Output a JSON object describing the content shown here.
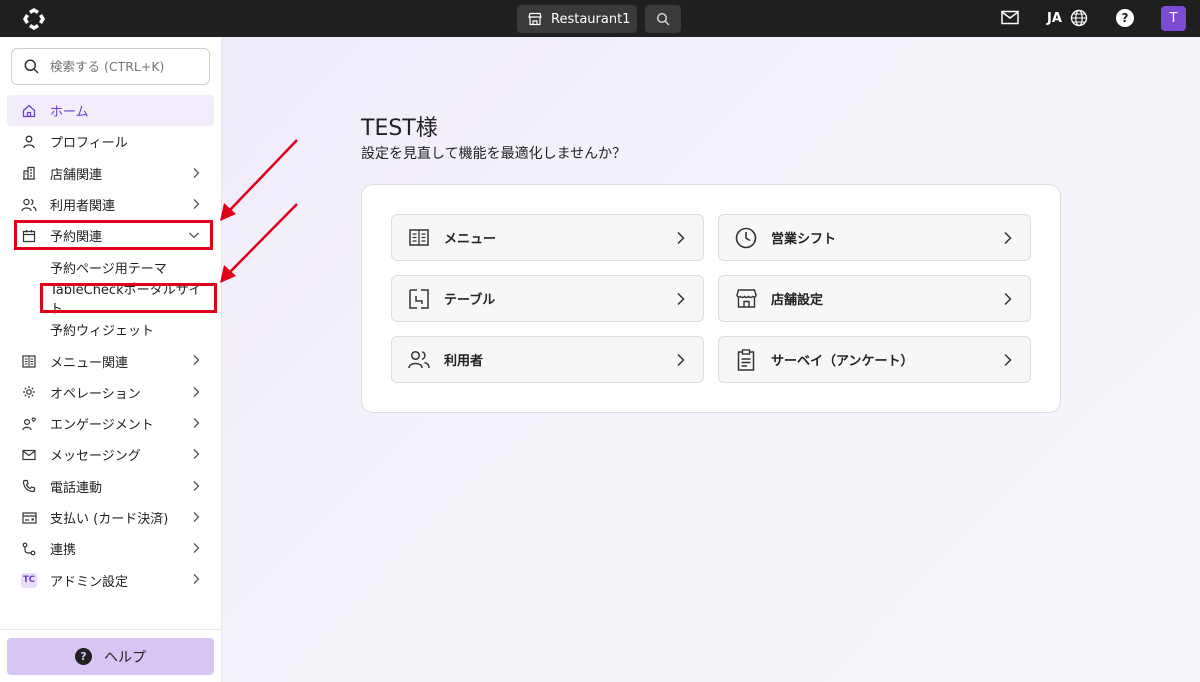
{
  "topbar": {
    "store_name": "Restaurant1",
    "language": "JA",
    "help_glyph": "?",
    "avatar_initial": "T"
  },
  "sidebar": {
    "search_placeholder": "検索する (CTRL+K)",
    "items": [
      {
        "label": "ホーム",
        "icon": "home-icon",
        "active": true
      },
      {
        "label": "プロフィール",
        "icon": "person-icon"
      },
      {
        "label": "店舗関連",
        "icon": "building-icon",
        "has_chevron": true
      },
      {
        "label": "利用者関連",
        "icon": "users-icon",
        "has_chevron": true
      },
      {
        "label": "予約関連",
        "icon": "calendar-icon",
        "expanded": true
      },
      {
        "label": "予約ページ用テーマ",
        "sub": true
      },
      {
        "label": "TableCheckポータルサイト",
        "sub": true
      },
      {
        "label": "予約ウィジェット",
        "sub": true
      },
      {
        "label": "メニュー関連",
        "icon": "menu-book-icon",
        "has_chevron": true
      },
      {
        "label": "オペレーション",
        "icon": "gear-icon",
        "has_chevron": true
      },
      {
        "label": "エンゲージメント",
        "icon": "engagement-icon",
        "has_chevron": true
      },
      {
        "label": "メッセージング",
        "icon": "mail-icon",
        "has_chevron": true
      },
      {
        "label": "電話連動",
        "icon": "phone-icon",
        "has_chevron": true
      },
      {
        "label": "支払い (カード決済)",
        "icon": "card-icon",
        "has_chevron": true
      },
      {
        "label": "連携",
        "icon": "integration-icon",
        "has_chevron": true
      },
      {
        "label": "アドミン設定",
        "icon": "tc-badge-icon",
        "badge_text": "TC",
        "has_chevron": true
      }
    ],
    "help_label": "ヘルプ",
    "help_glyph": "?"
  },
  "main": {
    "greeting": "TEST様",
    "subtitle": "設定を見直して機能を最適化しませんか？",
    "tiles": [
      {
        "label": "メニュー",
        "icon": "menu-book-icon"
      },
      {
        "label": "営業シフト",
        "icon": "clock-icon"
      },
      {
        "label": "テーブル",
        "icon": "table-icon"
      },
      {
        "label": "店舗設定",
        "icon": "store-icon"
      },
      {
        "label": "利用者",
        "icon": "users-icon"
      },
      {
        "label": "サーベイ（アンケート）",
        "icon": "clipboard-icon"
      }
    ]
  },
  "colors": {
    "topbar": "#1f1f1f",
    "accent": "#7b4bd6",
    "active_bg": "#f3ecfb",
    "highlight": "#e0001a"
  }
}
